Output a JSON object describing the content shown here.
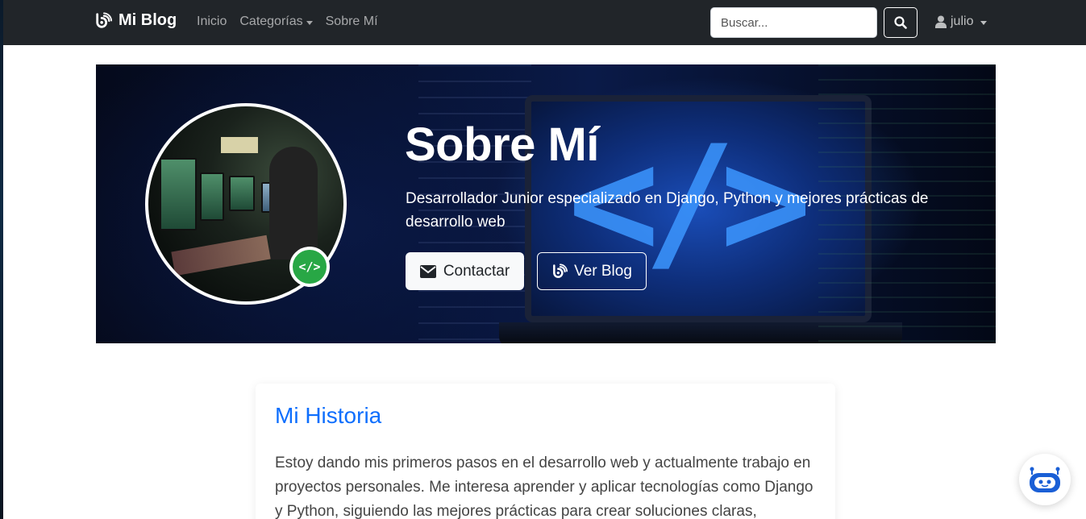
{
  "navbar": {
    "brand": "Mi Blog",
    "links": [
      {
        "label": "Inicio"
      },
      {
        "label": "Categorías"
      },
      {
        "label": "Sobre Mí"
      }
    ],
    "search_placeholder": "Buscar...",
    "user": "julio"
  },
  "hero": {
    "title": "Sobre Mí",
    "subtitle": "Desarrollador Junior especializado en Django, Python y mejores prácticas de desarrollo web",
    "contact_label": "Contactar",
    "blog_label": "Ver Blog",
    "badge_icon": "</>"
  },
  "section": {
    "title": "Mi Historia",
    "text": "Estoy dando mis primeros pasos en el desarrollo web y actualmente trabajo en proyectos personales. Me interesa aprender y aplicar tecnologías como Django y Python, siguiendo las mejores prácticas para crear soluciones claras,"
  },
  "colors": {
    "navbar_bg": "#212529",
    "accent": "#0d6efd",
    "badge": "#28a745"
  },
  "icons": {
    "brand": "blog-icon",
    "search": "search-icon",
    "user": "user-icon",
    "contact": "envelope-icon",
    "blog": "blog-icon",
    "chatbot": "robot-icon"
  }
}
